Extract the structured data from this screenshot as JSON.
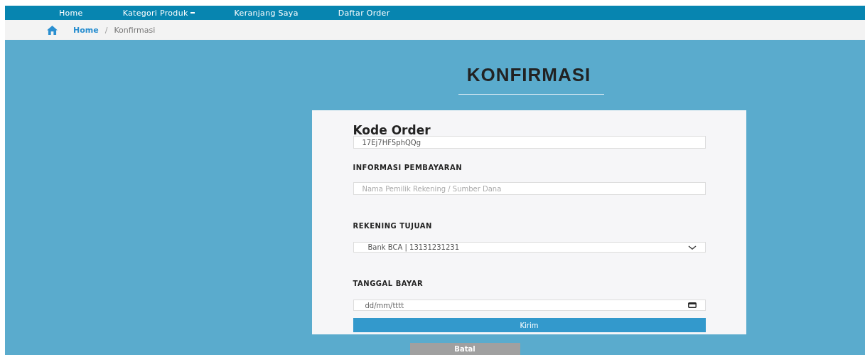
{
  "navbar": {
    "items": [
      {
        "label": "Home",
        "dropdown": false
      },
      {
        "label": "Kategori Produk",
        "dropdown": true
      },
      {
        "label": "Keranjang Saya",
        "dropdown": false
      },
      {
        "label": "Daftar Order",
        "dropdown": false
      }
    ]
  },
  "breadcrumb": {
    "separator": "/",
    "items": [
      {
        "label": "Home",
        "link": true
      },
      {
        "label": "Konfirmasi",
        "link": false
      }
    ]
  },
  "title": "KONFIRMASI",
  "form": {
    "order_code_label": "Kode Order",
    "order_code_value": "17Ej7HF5phQQg",
    "payment_label": "INFORMASI PEMBAYARAN",
    "payment_placeholder": "Nama Pemilik Rekening / Sumber Dana",
    "account_label": "REKENING TUJUAN",
    "account_value": "Bank BCA | 13131231231",
    "date_label": "TANGGAL BAYAR",
    "date_placeholder": "dd/mm/tttt",
    "submit": "Kirim"
  },
  "cancel": "Batal"
}
